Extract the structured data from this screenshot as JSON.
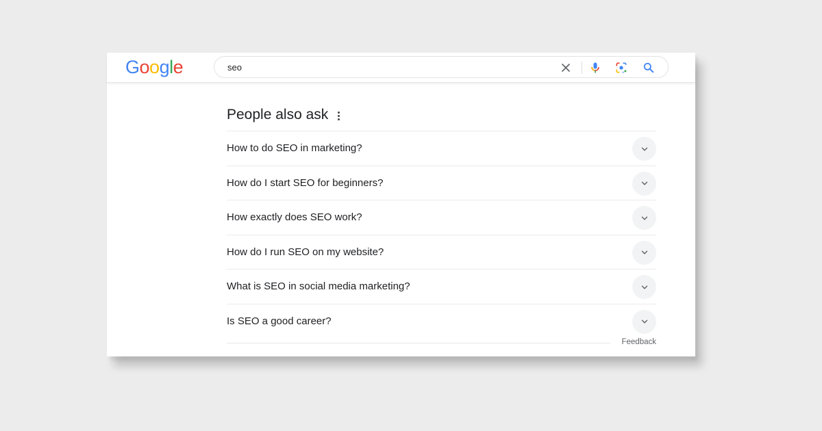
{
  "header": {
    "logo": {
      "letters": [
        "G",
        "o",
        "o",
        "g",
        "l",
        "e"
      ],
      "colors": [
        "#4285f4",
        "#ea4335",
        "#fbbc05",
        "#4285f4",
        "#34a853",
        "#ea4335"
      ]
    },
    "search": {
      "value": "seo",
      "icons": [
        "clear-icon",
        "microphone-icon",
        "lens-icon",
        "search-icon"
      ]
    }
  },
  "paa": {
    "title": "People also ask",
    "menu_icon": "more-vert-icon",
    "questions": [
      "How to do SEO in marketing?",
      "How do I start SEO for beginners?",
      "How exactly does SEO work?",
      "How do I run SEO on my website?",
      "What is SEO in social media marketing?",
      "Is SEO a good career?"
    ],
    "feedback_label": "Feedback"
  },
  "colors": {
    "blue": "#4285f4",
    "red": "#ea4335",
    "yellow": "#fbbc05",
    "green": "#34a853",
    "text": "#202124",
    "muted": "#5f6368"
  }
}
